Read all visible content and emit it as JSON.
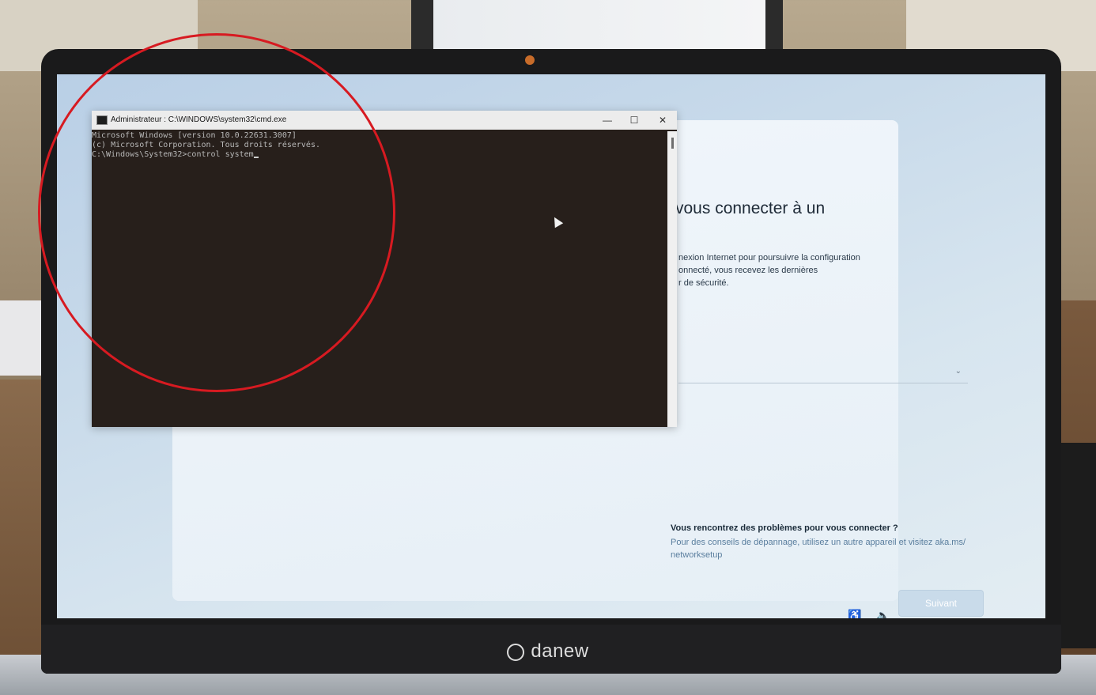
{
  "cmd": {
    "title": "Administrateur : C:\\WINDOWS\\system32\\cmd.exe",
    "minimize_glyph": "—",
    "maximize_glyph": "☐",
    "close_glyph": "✕",
    "lines": [
      "Microsoft Windows [version 10.0.22631.3007]",
      "(c) Microsoft Corporation. Tous droits réservés.",
      "",
      "C:\\Windows\\System32>control system"
    ]
  },
  "oobe": {
    "title": "vous connecter à un",
    "description_lines": [
      "nexion Internet pour poursuivre la configuration",
      "onnecté, vous recevez les dernières",
      "r de sécurité."
    ],
    "select_chevron": "⌄",
    "problem_title": "Vous rencontrez des problèmes pour vous connecter ?",
    "problem_text": "Pour des conseils de dépannage, utilisez un autre appareil et visitez aka.ms/ networksetup",
    "next_label": "Suivant",
    "accessibility_glyph": "♿",
    "speaker_glyph": "🔈"
  },
  "laptop": {
    "brand": "danew"
  },
  "annotation": {
    "circle_color": "#d71a21"
  }
}
